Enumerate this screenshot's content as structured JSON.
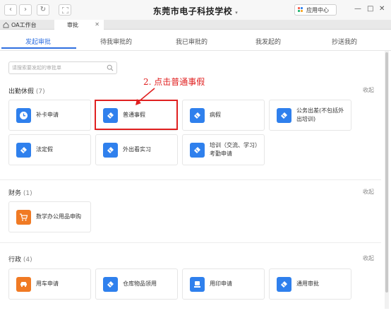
{
  "window": {
    "title": "东莞市电子科技学校",
    "app_center": "应用中心",
    "colors": {
      "accent": "#2f6fe0",
      "annotation": "#e02020",
      "icon_blue": "#2f80ed",
      "icon_orange": "#f07a24"
    }
  },
  "tabs": [
    {
      "label": "OA工作台"
    },
    {
      "label": "审批"
    }
  ],
  "subtabs": [
    {
      "label": "发起审批"
    },
    {
      "label": "待我审批的"
    },
    {
      "label": "我已审批的"
    },
    {
      "label": "我发起的"
    },
    {
      "label": "抄送我的"
    }
  ],
  "search": {
    "placeholder": "请搜索要发起的审批单"
  },
  "annotation": {
    "text": "2. 点击普通事假"
  },
  "sections": [
    {
      "title": "出勤休假",
      "count": "(7)",
      "collapse": "收起",
      "items": [
        {
          "label": "补卡申请",
          "icon": "clock-icon"
        },
        {
          "label": "普通事假",
          "icon": "ribbon-icon"
        },
        {
          "label": "病假",
          "icon": "ribbon-icon"
        },
        {
          "label": "公务出差(不包括外出培训)",
          "icon": "ribbon-icon"
        },
        {
          "label": "法定假",
          "icon": "ribbon-icon"
        },
        {
          "label": "外出看实习",
          "icon": "ribbon-icon"
        },
        {
          "label": "培训（交流、学习）考勤申请",
          "icon": "ribbon-icon"
        }
      ]
    },
    {
      "title": "财务",
      "count": "(1)",
      "collapse": "收起",
      "items": [
        {
          "label": "数学办公用品申购",
          "icon": "cart-icon"
        }
      ]
    },
    {
      "title": "行政",
      "count": "(4)",
      "collapse": "收起",
      "items": [
        {
          "label": "用车申请",
          "icon": "car-icon"
        },
        {
          "label": "仓库物品领用",
          "icon": "ribbon-icon"
        },
        {
          "label": "用印申请",
          "icon": "stamp-icon"
        },
        {
          "label": "通用审批",
          "icon": "ribbon-icon"
        }
      ]
    }
  ]
}
